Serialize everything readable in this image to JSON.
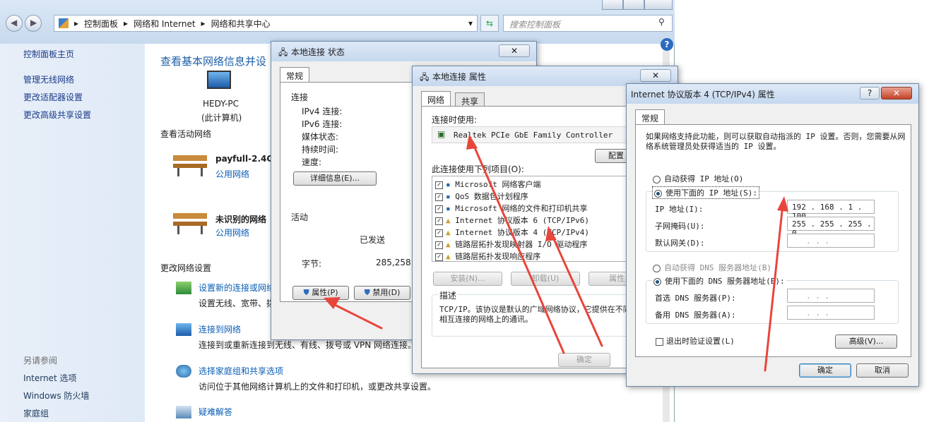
{
  "explorer": {
    "breadcrumb": [
      "控制面板",
      "网络和 Internet",
      "网络和共享中心"
    ],
    "search_placeholder": "搜索控制面板",
    "left": {
      "home": "控制面板主页",
      "links": [
        "管理无线网络",
        "更改适配器设置",
        "更改高级共享设置"
      ],
      "see_also": "另请参阅",
      "see_also_links": [
        "Internet 选项",
        "Windows 防火墙",
        "家庭组"
      ]
    },
    "main": {
      "title": "查看基本网络信息并设",
      "pc_name": "HEDY-PC",
      "pc_sub": "(此计算机)",
      "active_heading": "查看活动网络",
      "net1_name": "payfull-2.4G",
      "net1_type": "公用网络",
      "net2_name": "未识别的网络",
      "net2_type": "公用网络",
      "change_heading": "更改网络设置",
      "items": [
        {
          "link": "设置新的连接或网络",
          "desc": "设置无线、宽带、拨"
        },
        {
          "link": "连接到网络",
          "desc": "连接到或重新连接到无线、有线、拨号或 VPN 网络连接。"
        },
        {
          "link": "选择家庭组和共享选项",
          "desc": "访问位于其他网络计算机上的文件和打印机，或更改共享设置。"
        },
        {
          "link": "疑难解答",
          "desc": ""
        }
      ]
    }
  },
  "status_dlg": {
    "title": "本地连接 状态",
    "tab": "常规",
    "conn_heading": "连接",
    "rows": [
      "IPv4 连接:",
      "IPv6 连接:",
      "媒体状态:",
      "持续时间:",
      "速度:"
    ],
    "details_btn": "详细信息(E)...",
    "activity": "活动",
    "sent": "已发送",
    "bytes_label": "字节:",
    "bytes_value": "285,258",
    "props_btn": "属性(P)",
    "disable_btn": "禁用(D)"
  },
  "props_dlg": {
    "title": "本地连接 属性",
    "tabs": [
      "网络",
      "共享"
    ],
    "connect_using": "连接时使用:",
    "adapter": "Realtek PCIe GbE Family Controller",
    "config_btn": "配置",
    "items_label": "此连接使用下列项目(O):",
    "items": [
      "Microsoft 网络客户端",
      "QoS 数据包计划程序",
      "Microsoft 网络的文件和打印机共享",
      "Internet 协议版本 6 (TCP/IPv6)",
      "Internet 协议版本 4 (TCP/IPv4)",
      "链路层拓扑发现映射器 I/O 驱动程序",
      "链路层拓扑发现响应程序"
    ],
    "install_btn": "安装(N)...",
    "uninstall_btn": "卸载(U)",
    "props_btn": "属性",
    "desc_label": "描述",
    "desc_text": "TCP/IP。该协议是默认的广域网络协议，它提供在不同的相互连接的网络上的通讯。",
    "ok_btn": "确定"
  },
  "ipv4_dlg": {
    "title": "Internet 协议版本 4 (TCP/IPv4) 属性",
    "help": "?",
    "tab": "常规",
    "intro": "如果网络支持此功能，则可以获取自动指派的 IP 设置。否则，您需要从网络系统管理员处获得适当的 IP 设置。",
    "auto_ip": "自动获得 IP 地址(O)",
    "manual_ip": "使用下面的 IP 地址(S):",
    "ip_label": "IP 地址(I):",
    "ip_value": "192 . 168 .  1  . 100",
    "mask_label": "子网掩码(U):",
    "mask_value": "255 . 255 . 255 .  0",
    "gw_label": "默认网关(D):",
    "gw_value": ".   .   .",
    "auto_dns": "自动获得 DNS 服务器地址(B)",
    "manual_dns": "使用下面的 DNS 服务器地址(E):",
    "dns1_label": "首选 DNS 服务器(P):",
    "dns2_label": "备用 DNS 服务器(A):",
    "dns_value": ".   .   .",
    "validate": "退出时验证设置(L)",
    "advanced_btn": "高级(V)...",
    "ok_btn": "确定",
    "cancel_btn": "取消"
  }
}
